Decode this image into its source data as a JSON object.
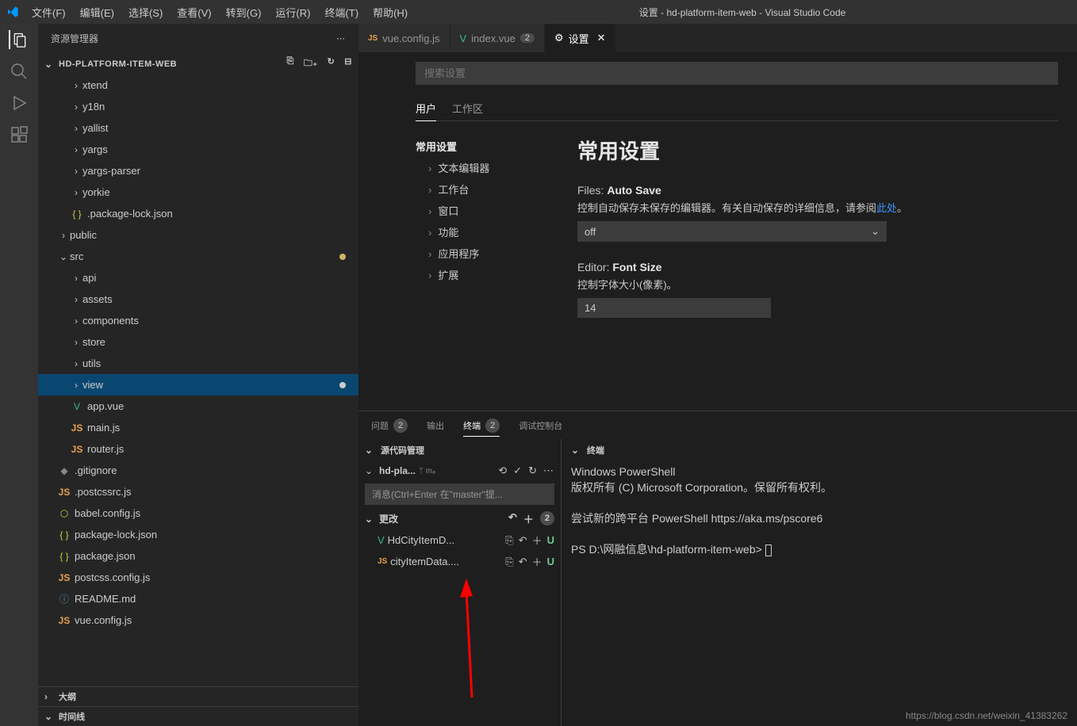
{
  "titlebar": {
    "menus": [
      "文件(F)",
      "编辑(E)",
      "选择(S)",
      "查看(V)",
      "转到(G)",
      "运行(R)",
      "终端(T)",
      "帮助(H)"
    ],
    "title": "设置 - hd-platform-item-web - Visual Studio Code"
  },
  "sidebar": {
    "header": "资源管理器",
    "project": "HD-PLATFORM-ITEM-WEB",
    "outline": "大纲",
    "timeline": "时间线"
  },
  "tree": {
    "xtend": "xtend",
    "y18n": "y18n",
    "yallist": "yallist",
    "yargs": "yargs",
    "yargs_parser": "yargs-parser",
    "yorkie": "yorkie",
    "package_lock_json": ".package-lock.json",
    "public": "public",
    "src": "src",
    "api": "api",
    "assets": "assets",
    "components": "components",
    "store": "store",
    "utils": "utils",
    "view": "view",
    "app_vue": "app.vue",
    "main_js": "main.js",
    "router_js": "router.js",
    "gitignore": ".gitignore",
    "postcssrc": ".postcssrc.js",
    "babel": "babel.config.js",
    "pkg_lock": "package-lock.json",
    "pkg": "package.json",
    "postcss": "postcss.config.js",
    "readme": "README.md",
    "vueconfig": "vue.config.js"
  },
  "tabs": {
    "vueconfig": "vue.config.js",
    "index_vue": "index.vue",
    "index_badge": "2",
    "settings": "设置"
  },
  "settings": {
    "search_placeholder": "搜索设置",
    "tab_user": "用户",
    "tab_workspace": "工作区",
    "nav_common": "常用设置",
    "nav_text_editor": "文本编辑器",
    "nav_workbench": "工作台",
    "nav_window": "窗口",
    "nav_features": "功能",
    "nav_app": "应用程序",
    "nav_ext": "扩展",
    "detail_title": "常用设置",
    "autosave_pref": "Files: ",
    "autosave_key": "Auto Save",
    "autosave_desc1": "控制自动保存未保存的编辑器。有关自动保存的详细信息，请参阅",
    "autosave_link": "此处",
    "autosave_desc2": "。",
    "autosave_value": "off",
    "fontsize_pref": "Editor: ",
    "fontsize_key": "Font Size",
    "fontsize_desc": "控制字体大小(像素)。",
    "fontsize_value": "14"
  },
  "panel": {
    "problems": "问题",
    "problems_count": "2",
    "output": "输出",
    "terminal": "终端",
    "terminal_count": "2",
    "debug": "调试控制台"
  },
  "scm": {
    "header": "源代码管理",
    "repo": "hd-pla...",
    "branch": "master",
    "input_placeholder": "消息(Ctrl+Enter 在\"master\"提...",
    "changes": "更改",
    "changes_count": "2",
    "file1": "HdCityItemD...",
    "file2": "cityItemData....",
    "status": "U"
  },
  "terminal": {
    "header": "终端",
    "line1": "Windows PowerShell",
    "line2": "版权所有 (C) Microsoft Corporation。保留所有权利。",
    "line3": "尝试新的跨平台 PowerShell https://aka.ms/pscore6",
    "prompt": "PS D:\\网融信息\\hd-platform-item-web> "
  },
  "footer_url": "https://blog.csdn.net/weixin_41383262"
}
